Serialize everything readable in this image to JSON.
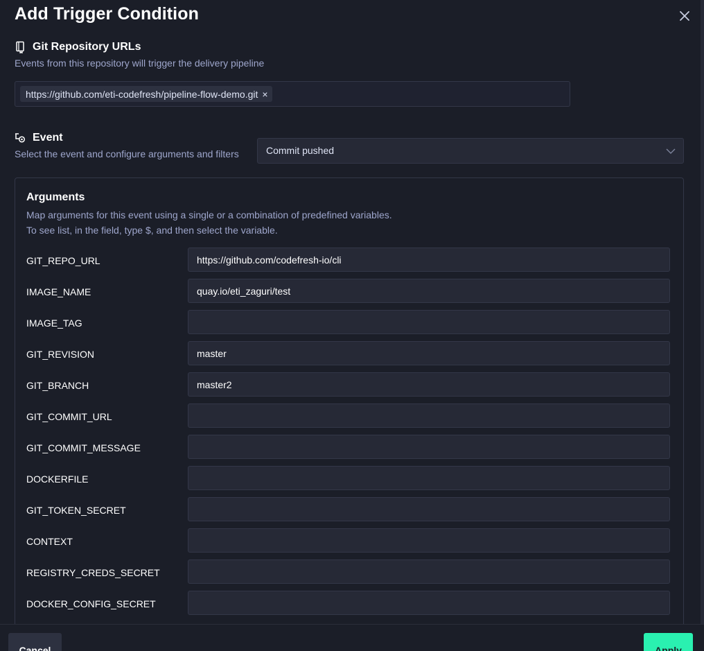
{
  "dialog": {
    "title": "Add Trigger Condition",
    "close_icon": "close-icon"
  },
  "repo": {
    "heading": "Git Repository URLs",
    "icon": "repository-icon",
    "description": "Events from this repository will trigger the delivery pipeline",
    "urls": [
      "https://github.com/eti-codefresh/pipeline-flow-demo.git"
    ],
    "remove_glyph": "×"
  },
  "event": {
    "heading": "Event",
    "icon": "event-trigger-icon",
    "description": "Select the event and configure arguments and filters",
    "selected": "Commit pushed",
    "chevron_icon": "chevron-down-icon"
  },
  "arguments": {
    "title": "Arguments",
    "desc_line1": "Map arguments for this event using a single or a combination of predefined variables.",
    "desc_line2": "To see list, in the field, type $, and then select the variable.",
    "rows": [
      {
        "label": "GIT_REPO_URL",
        "value": "https://github.com/codefresh-io/cli"
      },
      {
        "label": "IMAGE_NAME",
        "value": "quay.io/eti_zaguri/test"
      },
      {
        "label": "IMAGE_TAG",
        "value": ""
      },
      {
        "label": "GIT_REVISION",
        "value": "master"
      },
      {
        "label": "GIT_BRANCH",
        "value": "master2"
      },
      {
        "label": "GIT_COMMIT_URL",
        "value": ""
      },
      {
        "label": "GIT_COMMIT_MESSAGE",
        "value": ""
      },
      {
        "label": "DOCKERFILE",
        "value": ""
      },
      {
        "label": "GIT_TOKEN_SECRET",
        "value": ""
      },
      {
        "label": "CONTEXT",
        "value": ""
      },
      {
        "label": "REGISTRY_CREDS_SECRET",
        "value": ""
      },
      {
        "label": "DOCKER_CONFIG_SECRET",
        "value": ""
      }
    ]
  },
  "footer": {
    "cancel_label": "Cancel",
    "apply_label": "Apply"
  },
  "colors": {
    "background": "#1b1e28",
    "field_bg": "#262936",
    "border": "#333748",
    "muted_text": "#9ea6cc",
    "accent": "#2af0b0"
  }
}
